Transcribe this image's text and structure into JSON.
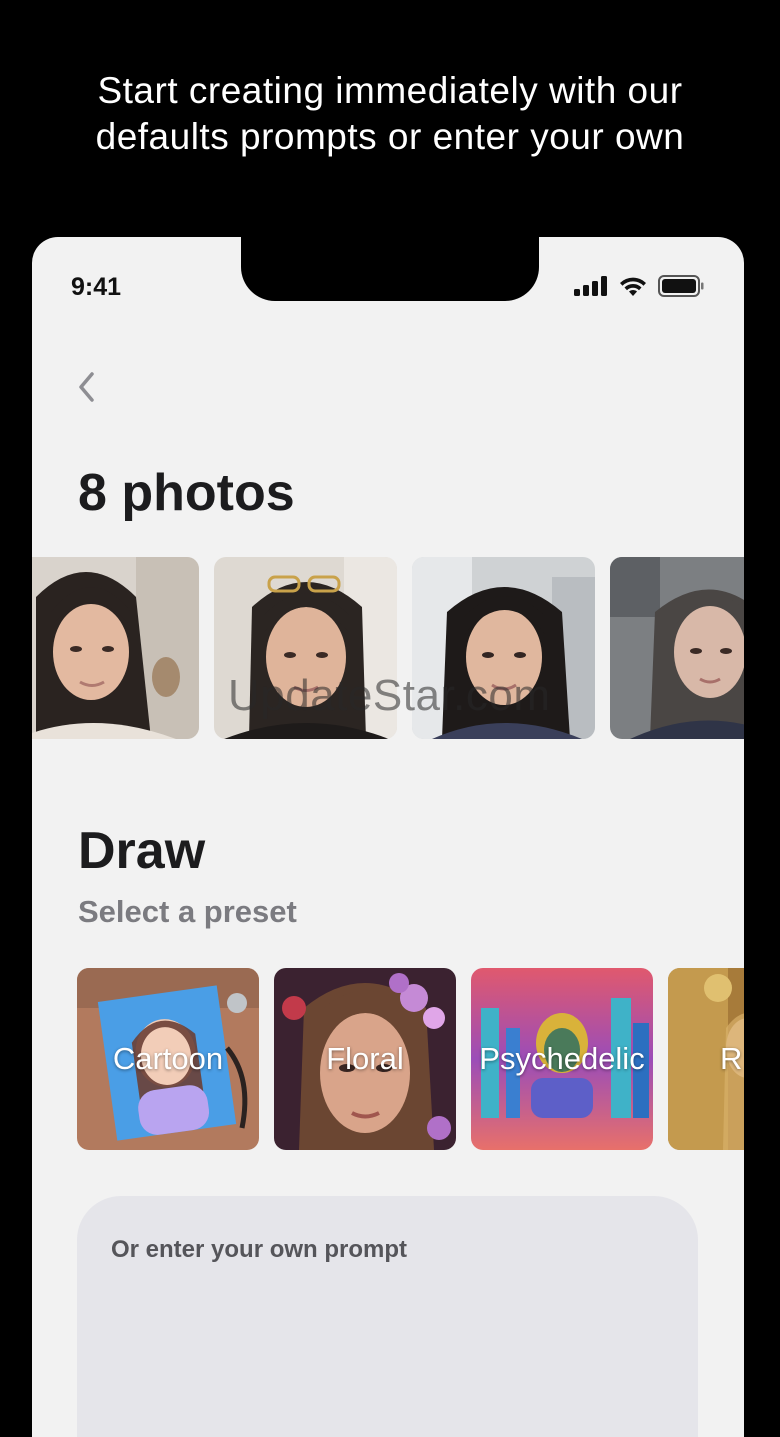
{
  "headline": {
    "line1": "Start creating immediately with our",
    "line2": "defaults prompts or enter your own"
  },
  "status_bar": {
    "time": "9:41",
    "icons": [
      "signal-icon",
      "wifi-icon",
      "battery-icon"
    ]
  },
  "nav": {
    "back_icon": "chevron-left-icon"
  },
  "photos": {
    "title": "8 photos",
    "count_visible": 4
  },
  "watermark": "UpdateStar.com",
  "draw": {
    "title": "Draw",
    "subtitle": "Select a preset",
    "presets": [
      {
        "label": "Cartoon"
      },
      {
        "label": "Floral"
      },
      {
        "label": "Psychedelic"
      },
      {
        "label": "R"
      }
    ]
  },
  "prompt": {
    "placeholder": "Or enter your own prompt",
    "value": ""
  },
  "colors": {
    "background": "#000000",
    "screen": "#f2f2f2",
    "prompt_box": "#e5e5ea",
    "title_text": "#1c1c1e",
    "subtitle_text": "#7b7b80"
  }
}
